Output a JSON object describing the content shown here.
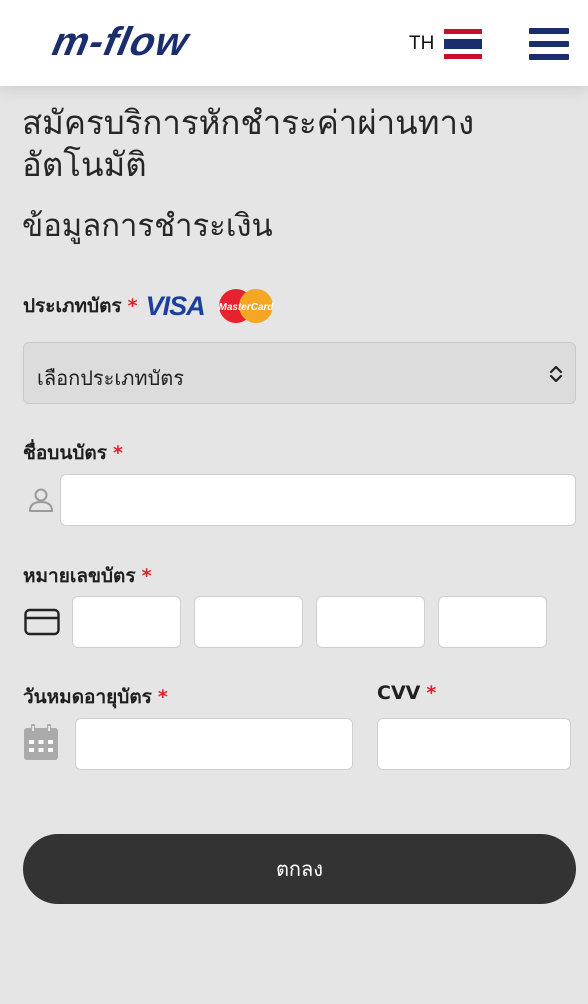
{
  "header": {
    "logo_text": "m-flow",
    "language_label": "TH",
    "language_flag": "thailand-flag-icon",
    "menu_icon": "hamburger-menu-icon",
    "logo_color": "#1a2e6e"
  },
  "page": {
    "title": "สมัครบริการหักชำระค่าผ่านทางอัตโนมัติ",
    "section_title": "ข้อมูลการชำระเงิน"
  },
  "form": {
    "required_mark": "*",
    "card_type": {
      "label": "ประเภทบัตร",
      "brand_visa": "VISA",
      "brand_mastercard": "MasterCard",
      "selected": "เลือกประเภทบัตร"
    },
    "card_name": {
      "label": "ชื่อบนบัตร",
      "value": "",
      "icon": "user-icon"
    },
    "card_number": {
      "label": "หมายเลขบัตร",
      "groups": [
        "",
        "",
        "",
        ""
      ],
      "icon": "credit-card-icon"
    },
    "expiry": {
      "label": "วันหมดอายุบัตร",
      "value": "",
      "icon": "calendar-icon"
    },
    "cvv": {
      "label": "CVV",
      "value": ""
    },
    "submit_label": "ตกลง"
  },
  "colors": {
    "background": "#e5e5e5",
    "brand_navy": "#1a2e6e",
    "required": "#d9232a",
    "button": "#333333"
  }
}
